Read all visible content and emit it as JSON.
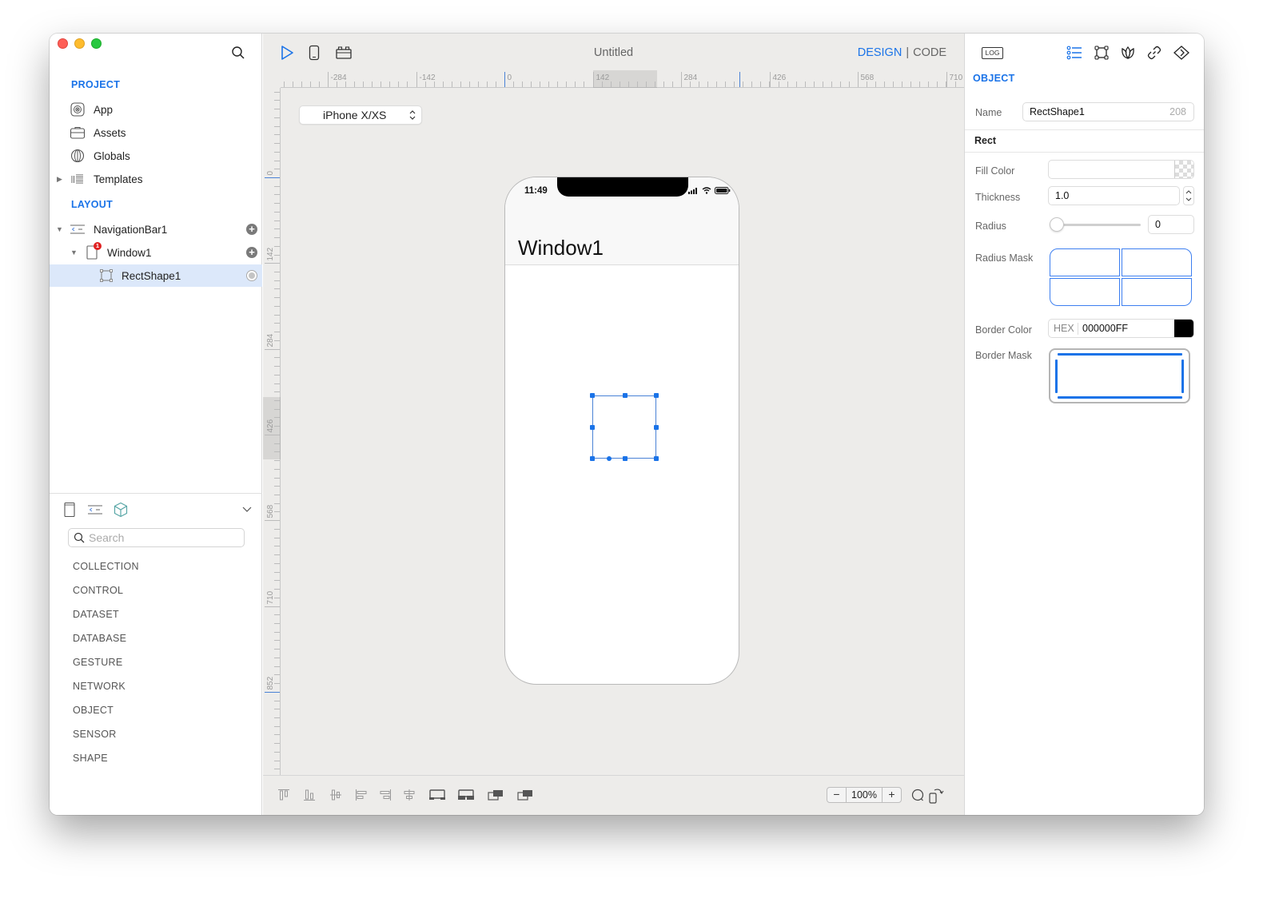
{
  "window": {
    "title": "Untitled"
  },
  "sidebar": {
    "project_label": "PROJECT",
    "project_items": [
      {
        "label": "App",
        "icon": "app-icon"
      },
      {
        "label": "Assets",
        "icon": "briefcase-icon"
      },
      {
        "label": "Globals",
        "icon": "globe-icon"
      },
      {
        "label": "Templates",
        "icon": "templates-icon"
      }
    ],
    "layout_label": "LAYOUT",
    "layout_items": [
      {
        "label": "NavigationBar1",
        "icon": "navigation-bar-icon",
        "expanded": true
      },
      {
        "label": "Window1",
        "icon": "window-icon",
        "expanded": true,
        "badge": "1"
      },
      {
        "label": "RectShape1",
        "icon": "rect-shape-icon",
        "selected": true
      }
    ],
    "library": {
      "search_placeholder": "Search",
      "search_value": "",
      "categories": [
        "COLLECTION",
        "CONTROL",
        "DATASET",
        "DATABASE",
        "GESTURE",
        "NETWORK",
        "OBJECT",
        "SENSOR",
        "SHAPE"
      ]
    }
  },
  "toolbar": {
    "mode_design": "DESIGN",
    "mode_separator": "|",
    "mode_code": "CODE",
    "active_mode": "DESIGN"
  },
  "canvas": {
    "hruler_labels": [
      "-284",
      "-142",
      "0",
      "142",
      "284",
      "426",
      "568",
      "710"
    ],
    "vruler_labels": [
      "0",
      "142",
      "284",
      "426",
      "568",
      "710",
      "852"
    ],
    "device": "iPhone X/XS",
    "phone": {
      "time": "11:49",
      "window_title": "Window1"
    }
  },
  "bottombar": {
    "zoom_minus": "−",
    "zoom_value": "100%",
    "zoom_plus": "+"
  },
  "inspector": {
    "log_label": "LOG",
    "section": "OBJECT",
    "name_label": "Name",
    "name_value": "RectShape1",
    "name_id": "208",
    "group": "Rect",
    "fill_color_label": "Fill Color",
    "thickness_label": "Thickness",
    "thickness_value": "1.0",
    "radius_label": "Radius",
    "radius_value": "0",
    "radius_slider_fraction": 0,
    "radius_mask_label": "Radius Mask",
    "border_color_label": "Border Color",
    "border_color_format": "HEX",
    "border_color_value": "000000FF",
    "border_color_swatch": "#000000",
    "border_mask_label": "Border Mask"
  },
  "colors": {
    "accent": "#1a73e8",
    "selection": "#dce8fa"
  }
}
